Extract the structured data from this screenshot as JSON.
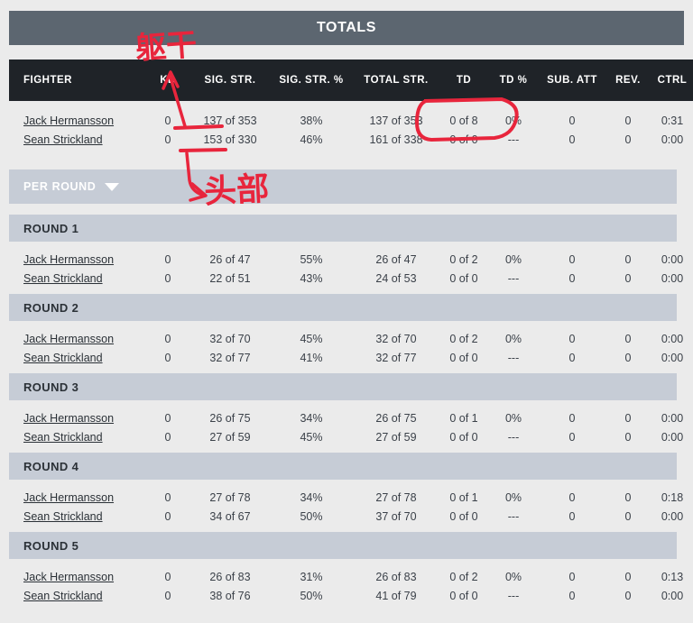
{
  "title": "TOTALS",
  "columns": [
    "FIGHTER",
    "KD",
    "SIG. STR.",
    "SIG. STR. %",
    "TOTAL STR.",
    "TD",
    "TD %",
    "SUB. ATT",
    "REV.",
    "CTRL"
  ],
  "totals_rows": [
    {
      "fighter": "Jack Hermansson",
      "kd": "0",
      "sig_str": "137 of 353",
      "sig_str_pct": "38%",
      "total_str": "137 of 353",
      "td": "0 of 8",
      "td_pct": "0%",
      "sub_att": "0",
      "rev": "0",
      "ctrl": "0:31"
    },
    {
      "fighter": "Sean Strickland",
      "kd": "0",
      "sig_str": "153 of 330",
      "sig_str_pct": "46%",
      "total_str": "161 of 338",
      "td": "0 of 0",
      "td_pct": "---",
      "sub_att": "0",
      "rev": "0",
      "ctrl": "0:00"
    }
  ],
  "per_round": {
    "label": "PER ROUND",
    "caret_icon": "chevron-down-icon"
  },
  "rounds": [
    {
      "label": "ROUND 1",
      "rows": [
        {
          "fighter": "Jack Hermansson",
          "kd": "0",
          "sig_str": "26 of 47",
          "sig_str_pct": "55%",
          "total_str": "26 of 47",
          "td": "0 of 2",
          "td_pct": "0%",
          "sub_att": "0",
          "rev": "0",
          "ctrl": "0:00"
        },
        {
          "fighter": "Sean Strickland",
          "kd": "0",
          "sig_str": "22 of 51",
          "sig_str_pct": "43%",
          "total_str": "24 of 53",
          "td": "0 of 0",
          "td_pct": "---",
          "sub_att": "0",
          "rev": "0",
          "ctrl": "0:00"
        }
      ]
    },
    {
      "label": "ROUND 2",
      "rows": [
        {
          "fighter": "Jack Hermansson",
          "kd": "0",
          "sig_str": "32 of 70",
          "sig_str_pct": "45%",
          "total_str": "32 of 70",
          "td": "0 of 2",
          "td_pct": "0%",
          "sub_att": "0",
          "rev": "0",
          "ctrl": "0:00"
        },
        {
          "fighter": "Sean Strickland",
          "kd": "0",
          "sig_str": "32 of 77",
          "sig_str_pct": "41%",
          "total_str": "32 of 77",
          "td": "0 of 0",
          "td_pct": "---",
          "sub_att": "0",
          "rev": "0",
          "ctrl": "0:00"
        }
      ]
    },
    {
      "label": "ROUND 3",
      "rows": [
        {
          "fighter": "Jack Hermansson",
          "kd": "0",
          "sig_str": "26 of 75",
          "sig_str_pct": "34%",
          "total_str": "26 of 75",
          "td": "0 of 1",
          "td_pct": "0%",
          "sub_att": "0",
          "rev": "0",
          "ctrl": "0:00"
        },
        {
          "fighter": "Sean Strickland",
          "kd": "0",
          "sig_str": "27 of 59",
          "sig_str_pct": "45%",
          "total_str": "27 of 59",
          "td": "0 of 0",
          "td_pct": "---",
          "sub_att": "0",
          "rev": "0",
          "ctrl": "0:00"
        }
      ]
    },
    {
      "label": "ROUND 4",
      "rows": [
        {
          "fighter": "Jack Hermansson",
          "kd": "0",
          "sig_str": "27 of 78",
          "sig_str_pct": "34%",
          "total_str": "27 of 78",
          "td": "0 of 1",
          "td_pct": "0%",
          "sub_att": "0",
          "rev": "0",
          "ctrl": "0:18"
        },
        {
          "fighter": "Sean Strickland",
          "kd": "0",
          "sig_str": "34 of 67",
          "sig_str_pct": "50%",
          "total_str": "37 of 70",
          "td": "0 of 0",
          "td_pct": "---",
          "sub_att": "0",
          "rev": "0",
          "ctrl": "0:00"
        }
      ]
    },
    {
      "label": "ROUND 5",
      "rows": [
        {
          "fighter": "Jack Hermansson",
          "kd": "0",
          "sig_str": "26 of 83",
          "sig_str_pct": "31%",
          "total_str": "26 of 83",
          "td": "0 of 2",
          "td_pct": "0%",
          "sub_att": "0",
          "rev": "0",
          "ctrl": "0:13"
        },
        {
          "fighter": "Sean Strickland",
          "kd": "0",
          "sig_str": "38 of 76",
          "sig_str_pct": "50%",
          "total_str": "41 of 79",
          "td": "0 of 0",
          "td_pct": "---",
          "sub_att": "0",
          "rev": "0",
          "ctrl": "0:00"
        }
      ]
    }
  ],
  "annotations": {
    "color": "#e8253c",
    "torso_text": "躯干",
    "head_text": "头部"
  },
  "colors": {
    "title_bar": "#5c6670",
    "header_row": "#1f2328",
    "round_bar": "#c6ccd6",
    "data_bg": "#ebebeb",
    "annotation_red": "#e8253c"
  }
}
